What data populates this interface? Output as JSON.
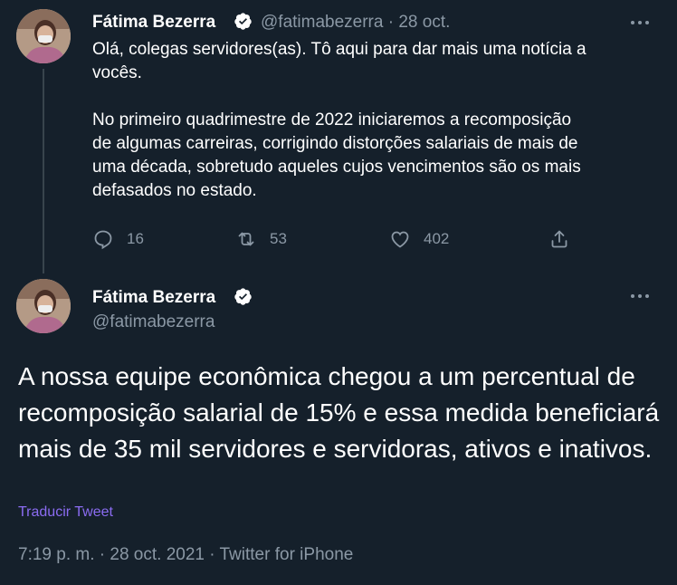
{
  "tweet1": {
    "author_name": "Fátima Bezerra",
    "handle": "@fatimabezerra",
    "separator": "·",
    "date": "28 oct.",
    "text": "Olá, colegas servidores(as). Tô aqui para dar mais uma notícia a\nvocês.\n\nNo primeiro quadrimestre de 2022 iniciaremos a recomposição\nde algumas carreiras, corrigindo distorções salariais de mais de\numa década, sobretudo aqueles cujos vencimentos são os mais\ndefasados no estado.",
    "replies": "16",
    "retweets": "53",
    "likes": "402"
  },
  "tweet2": {
    "author_name": "Fátima Bezerra",
    "handle": "@fatimabezerra",
    "text": "A nossa equipe econômica chegou a um percentual de recomposição salarial de 15% e essa medida beneficiará mais de 35 mil servidores e servidoras, ativos e inativos.",
    "translate_label": "Traducir Tweet",
    "timestamp": "7:19 p. m. · 28 oct. 2021 · Twitter for iPhone"
  },
  "icons": {
    "verified": "verified-badge-icon",
    "more": "more-options-icon",
    "reply": "reply-icon",
    "retweet": "retweet-icon",
    "like": "heart-icon",
    "share": "share-icon"
  },
  "colors": {
    "background": "#15202b",
    "text": "#ffffff",
    "muted": "#8b98a5",
    "link": "#8b6cf2",
    "thread_line": "#38444d"
  }
}
